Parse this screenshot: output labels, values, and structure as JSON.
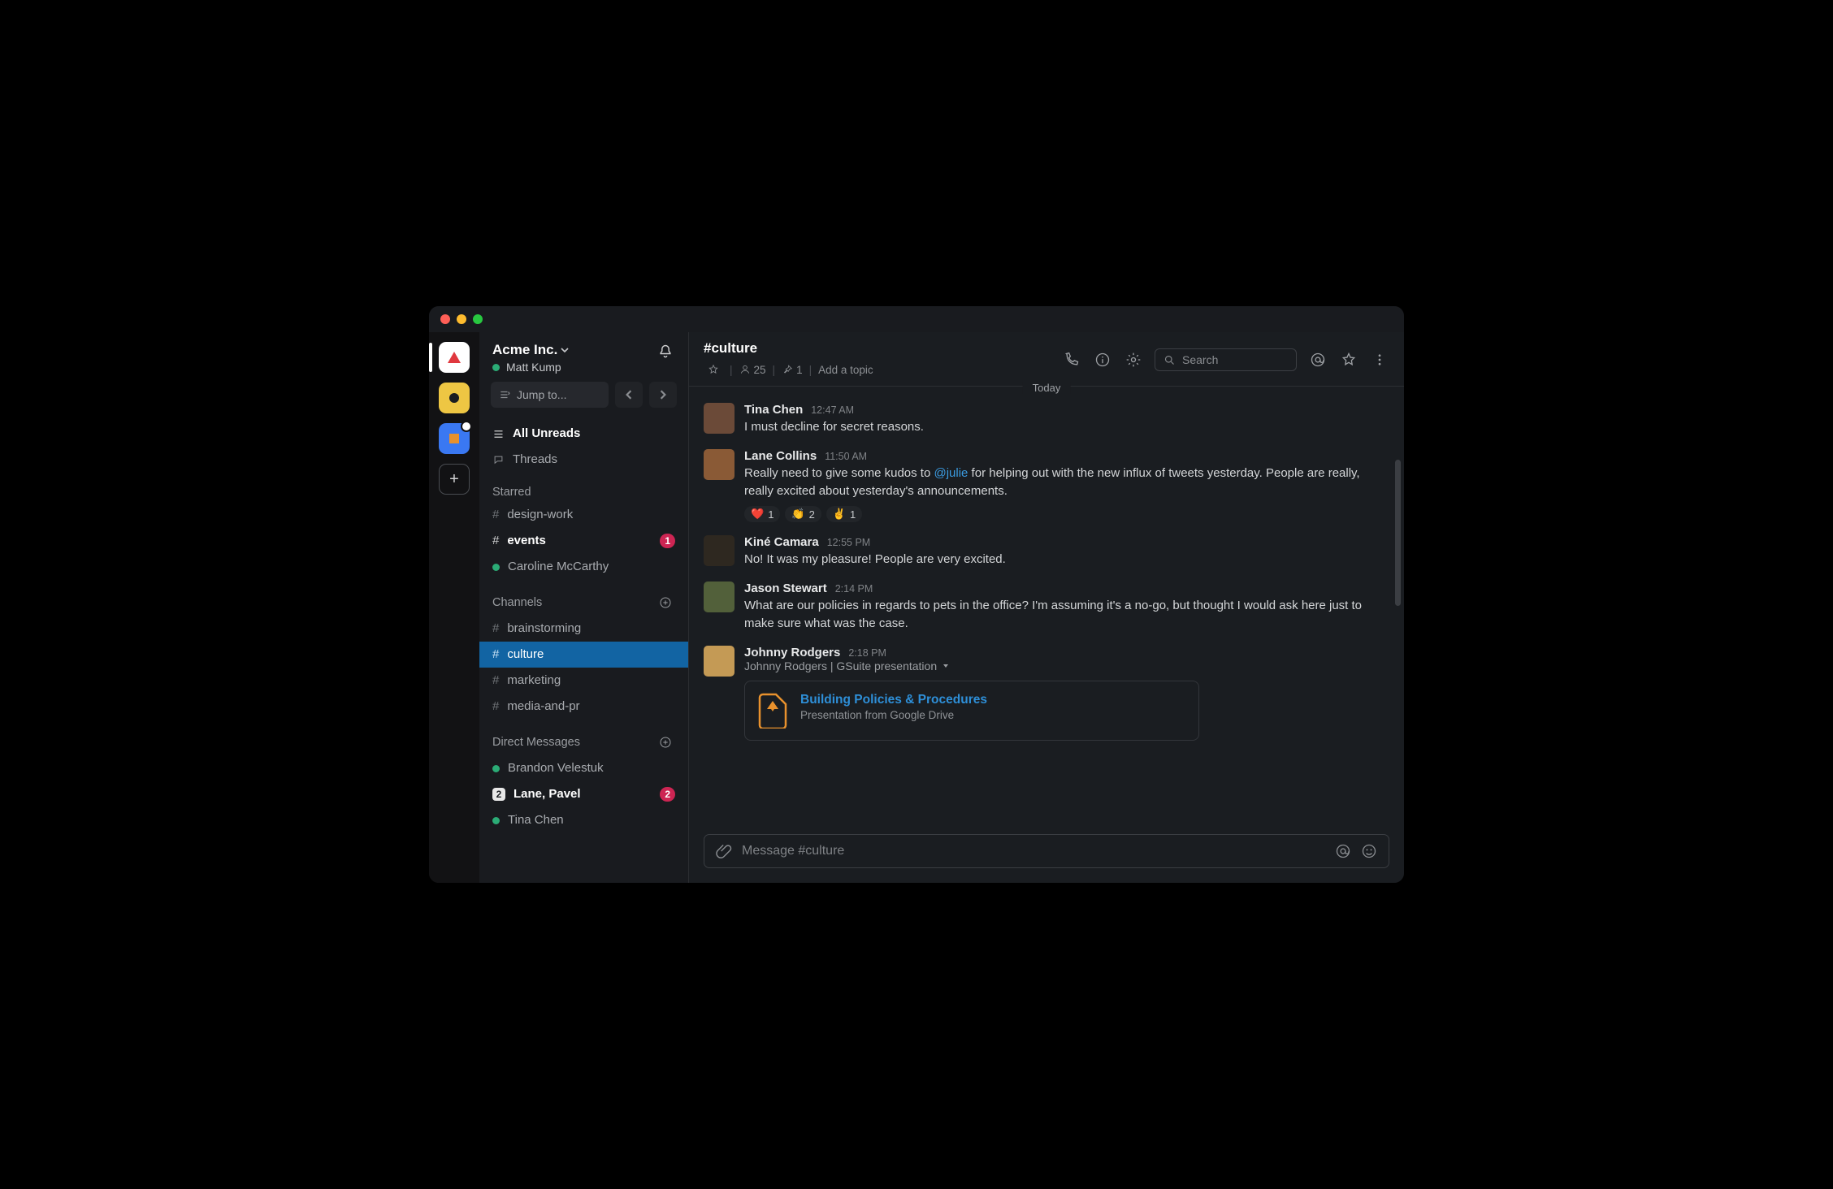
{
  "workspace": {
    "name": "Acme Inc.",
    "user": "Matt Kump"
  },
  "jump_placeholder": "Jump to...",
  "nav": {
    "all_unreads": "All Unreads",
    "threads": "Threads"
  },
  "sections": {
    "starred": "Starred",
    "channels": "Channels",
    "dms": "Direct Messages"
  },
  "starred": [
    {
      "label": "design-work",
      "type": "channel"
    },
    {
      "label": "events",
      "type": "channel",
      "bold": true,
      "badge": "1"
    },
    {
      "label": "Caroline McCarthy",
      "type": "dm"
    }
  ],
  "channels": [
    {
      "label": "brainstorming"
    },
    {
      "label": "culture",
      "active": true
    },
    {
      "label": "marketing"
    },
    {
      "label": "media-and-pr"
    }
  ],
  "dms": [
    {
      "label": "Brandon Velestuk",
      "presence": "active"
    },
    {
      "label": "Lane, Pavel",
      "count": "2",
      "bold": true,
      "badge": "2"
    },
    {
      "label": "Tina Chen",
      "presence": "active"
    }
  ],
  "channel": {
    "name": "#culture",
    "members": "25",
    "pins": "1",
    "topic": "Add a topic",
    "search_placeholder": "Search",
    "date_divider": "Today"
  },
  "messages": [
    {
      "user": "Tina Chen",
      "time": "12:47 AM",
      "text": "I must decline for secret reasons."
    },
    {
      "user": "Lane Collins",
      "time": "11:50 AM",
      "pre": "Really need to give some kudos to ",
      "mention": "@julie",
      "post": " for helping out with the new influx of tweets yesterday. People are really, really excited about yesterday's announcements.",
      "reactions": [
        {
          "emoji": "❤️",
          "count": "1"
        },
        {
          "emoji": "👏",
          "count": "2"
        },
        {
          "emoji": "✌️",
          "count": "1"
        }
      ]
    },
    {
      "user": "Kiné Camara",
      "time": "12:55 PM",
      "text": "No! It was my pleasure! People are very excited."
    },
    {
      "user": "Jason Stewart",
      "time": "2:14 PM",
      "text": "What are our policies in regards to pets in the office? I'm assuming it's a no-go, but thought I would ask here just to make sure what was the case."
    },
    {
      "user": "Johnny Rodgers",
      "time": "2:18 PM",
      "attach_label": "Johnny Rodgers | GSuite presentation",
      "attach_title": "Building Policies & Procedures",
      "attach_sub": "Presentation from Google Drive"
    }
  ],
  "composer": {
    "placeholder": "Message #culture"
  }
}
